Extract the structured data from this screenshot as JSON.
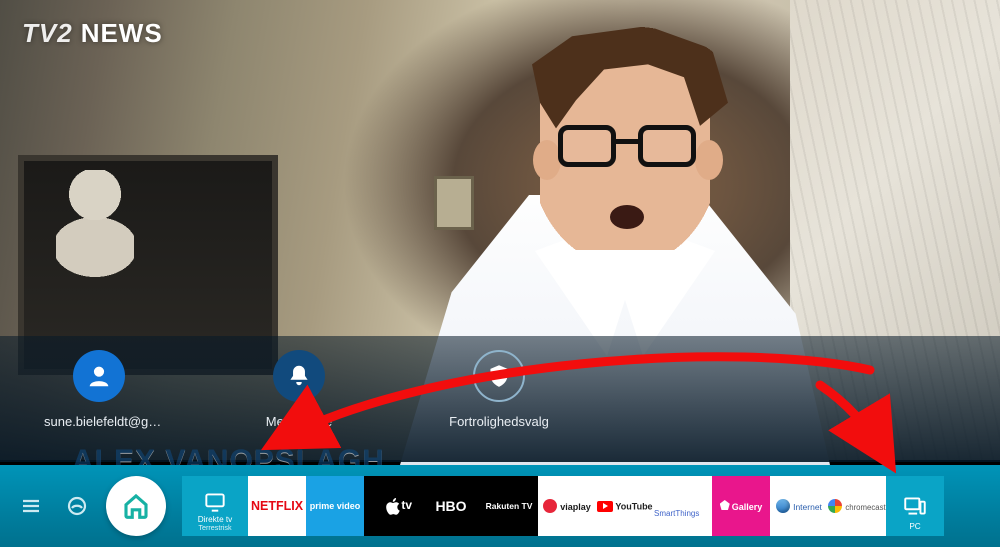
{
  "broadcast": {
    "network": "TV2",
    "program": "NEWS",
    "chyron": "ALEX VANOPSLAGH"
  },
  "settings": {
    "account": {
      "label": "sune.bielefeldt@g…"
    },
    "notifications": {
      "label": "Meddelelse"
    },
    "privacy": {
      "label": "Fortrolighedsvalg"
    }
  },
  "launcher": {
    "selected": {
      "label": "Direkte tv",
      "sublabel": "Terrestrisk"
    },
    "apps": [
      {
        "id": "netflix",
        "label": "NETFLIX"
      },
      {
        "id": "prime",
        "label": "prime video"
      },
      {
        "id": "appletv",
        "label": "tv"
      },
      {
        "id": "hbo",
        "label": "HBO"
      },
      {
        "id": "rakuten",
        "label": "Rakuten TV"
      },
      {
        "id": "viaplay",
        "label": "viaplay"
      },
      {
        "id": "youtube",
        "label": "YouTube"
      },
      {
        "id": "smart",
        "label": "SmartThings"
      },
      {
        "id": "gallery",
        "label": "Gallery"
      },
      {
        "id": "internet",
        "label": "Internet"
      },
      {
        "id": "chromecast",
        "label": "chromecast"
      },
      {
        "id": "pc",
        "label": "PC"
      }
    ]
  }
}
